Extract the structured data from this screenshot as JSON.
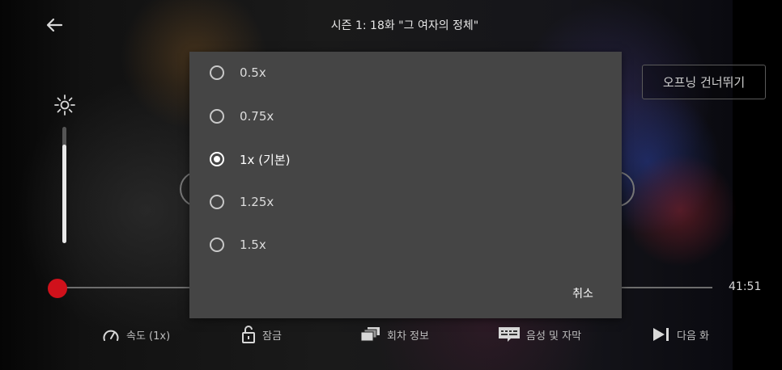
{
  "header": {
    "title": "시즌 1: 18화 \"그 여자의 정체\""
  },
  "skip_button_label": "오프닝 건너뛰기",
  "brightness": {
    "level": 0.85
  },
  "playback": {
    "remaining_time": "41:51",
    "progress": 0.0
  },
  "speed_dialog": {
    "options": [
      {
        "label": "0.5x",
        "selected": false
      },
      {
        "label": "0.75x",
        "selected": false
      },
      {
        "label": "1x (기본)",
        "selected": true
      },
      {
        "label": "1.25x",
        "selected": false
      },
      {
        "label": "1.5x",
        "selected": false
      }
    ],
    "cancel_label": "취소"
  },
  "bottom_bar": {
    "speed_label": "속도 (1x)",
    "lock_label": "잠금",
    "episodes_label": "회차 정보",
    "audio_subtitles_label": "음성 및 자막",
    "next_episode_label": "다음 화"
  },
  "colors": {
    "accent": "#d0111b",
    "dialog_bg": "#454545"
  }
}
